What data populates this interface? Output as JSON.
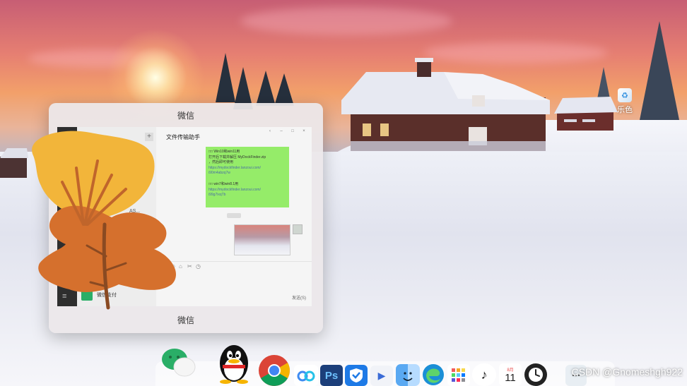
{
  "window": {
    "title": "微信",
    "footer": "微信",
    "chat_title": "文件传输助手",
    "win_buttons": [
      "‹",
      "–",
      "□",
      "×"
    ],
    "messages": [
      {
        "lines": [
          "□□ Win10和win11用",
          "打开后下载并解压 MyDockFinder.zip",
          "，然后即可使用",
          "https://mydockfinder.lanzoui.com/",
          "i90m4abzq7w"
        ]
      },
      {
        "lines": [
          "□□ win7和win8.1用",
          "https://mydockfinder.lanzoui.com/",
          "i99g7ixqTb"
        ]
      }
    ],
    "contact_fragment": "AS...",
    "contact_name": "微信支付",
    "tool_icons": [
      "☺",
      "⌂",
      "✂",
      "◷"
    ],
    "send_label": "发送(S)"
  },
  "desktop_icon": {
    "label": "乐色",
    "icon": "recycle-bin-icon"
  },
  "watermark": "CSDN @Gnomeshgh922",
  "dock": {
    "calendar_day": "11",
    "calendar_month": "8月",
    "apps": [
      "wechat-icon",
      "qq-icon",
      "chrome-icon",
      "baidu-netdisk-icon",
      "photoshop-icon",
      "tencent-pc-manager-icon",
      "video-player-icon",
      "finder-icon",
      "edge-icon",
      "app-grid-icon",
      "music-icon",
      "calendar-icon",
      "clock-icon",
      "more-icon"
    ],
    "ps_label": "Ps"
  },
  "colors": {
    "wechat_green": "#2aae67",
    "bubble_green": "#95ec69",
    "chrome_red": "#db4437",
    "chrome_yellow": "#f4b400",
    "chrome_green": "#0f9d58",
    "chrome_blue": "#4285f4",
    "photoshop_blue": "#1c3f7a",
    "leaf_yellow": "#f2b53a",
    "leaf_orange": "#d5702d"
  }
}
